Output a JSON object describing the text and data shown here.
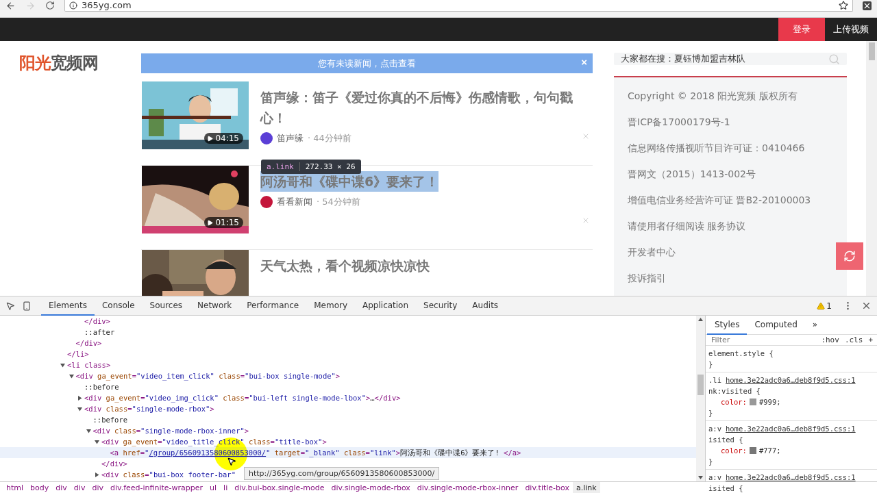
{
  "browser": {
    "url": "365yg.com",
    "forward_disabled": true
  },
  "header": {
    "login": "登录",
    "upload": "上传视频"
  },
  "logo": {
    "accent": "阳光",
    "rest": "宽频网"
  },
  "notice": {
    "text": "您有未读新闻，点击查看",
    "close": "×"
  },
  "feed": [
    {
      "title": "笛声缘：笛子《爱过你真的不后悔》伤感情歌，句句戳心！",
      "duration": "04:15",
      "source": "笛声缘",
      "dot": "·",
      "time": "44分钟前",
      "highlighted": false
    },
    {
      "title": "阿汤哥和《碟中谍6》要来了！",
      "duration": "01:15",
      "source": "看看新闻",
      "dot": "·",
      "time": "54分钟前",
      "highlighted": true
    },
    {
      "title": "天气太热，看个视频凉快凉快",
      "highlighted": false
    }
  ],
  "inspect_tooltip": {
    "selector": "a.link",
    "size": "272.33 × 26"
  },
  "search": {
    "placeholder": "大家都在搜：夏钰博加盟吉林队"
  },
  "footer_links": [
    "Copyright © 2018 阳光宽频 版权所有",
    "晋ICP备17000179号-1",
    "信息网络传播视听节目许可证：0410466",
    "晋网文（2015）1413-002号",
    "增值电信业务经营许可证 晋B2-20100003",
    "请使用者仔细阅读 服务协议",
    "开发者中心",
    "投诉指引"
  ],
  "devtools": {
    "tabs": [
      {
        "label": "Elements",
        "selected": true
      },
      {
        "label": "Console",
        "selected": false
      },
      {
        "label": "Sources",
        "selected": false
      },
      {
        "label": "Network",
        "selected": false
      },
      {
        "label": "Performance",
        "selected": false
      },
      {
        "label": "Memory",
        "selected": false
      },
      {
        "label": "Application",
        "selected": false
      },
      {
        "label": "Security",
        "selected": false
      },
      {
        "label": "Audits",
        "selected": false
      }
    ],
    "warnings": "1",
    "tree": [
      {
        "children": [
          {
            "children": [
              {
                "text": "</div>"
              },
              {
                "text": "::after"
              }
            ]
          },
          {
            "text": "</div>"
          }
        ]
      },
      {
        "text": "</li>"
      },
      {
        "text": "<li class>",
        "expanded": true,
        "children": [
          {
            "text": "<div ga_event=\"video_item_click\" class=\"bui-box single-mode\">",
            "expanded": true,
            "children": [
              {
                "text": "::before"
              },
              {
                "text": "<div ga_event=\"video_img_click\" class=\"bui-left single-mode-lbox\">…</div>",
                "expanded": false
              },
              {
                "text": "<div class=\"single-mode-rbox\">",
                "expanded": true,
                "children": [
                  {
                    "text": "::before"
                  },
                  {
                    "text": "<div class=\"single-mode-rbox-inner\">",
                    "expanded": true,
                    "children": [
                      {
                        "text": "<div ga_event=\"video_title_click\" class=\"title-box\">",
                        "expanded": true,
                        "children": [
                          {
                            "text": "<a href=\"/group/6560913580600853000/\" target=\"_blank\" class=\"link\">阿汤哥和《碟中谍6》要来了! </a>",
                            "selected": true
                          }
                        ]
                      },
                      {
                        "text": "</div>"
                      },
                      {
                        "text": "<div class=\"bui-box footer-bar\"",
                        "expanded": false
                      }
                    ]
                  }
                ]
              }
            ]
          }
        ]
      }
    ],
    "link_tooltip": "http://365yg.com/group/6560913580600853000/",
    "breadcrumbs": [
      {
        "label": "html",
        "selected": false
      },
      {
        "label": "body",
        "selected": false
      },
      {
        "label": "div",
        "selected": false
      },
      {
        "label": "div",
        "selected": false
      },
      {
        "label": "div",
        "selected": false
      },
      {
        "label": "div.feed-infinite-wrapper",
        "selected": false
      },
      {
        "label": "ul",
        "selected": false
      },
      {
        "label": "li",
        "selected": false
      },
      {
        "label": "div.bui-box.single-mode",
        "selected": false
      },
      {
        "label": "div.single-mode-rbox",
        "selected": false
      },
      {
        "label": "div.single-mode-rbox-inner",
        "selected": false
      },
      {
        "label": "div.title-box",
        "selected": false
      },
      {
        "label": "a.link",
        "selected": true
      }
    ],
    "styles_tabs": [
      {
        "label": "Styles",
        "selected": true
      },
      {
        "label": "Computed",
        "selected": false
      }
    ],
    "more_tabs": "»",
    "filter": {
      "placeholder": "Filter"
    },
    "filter_buttons": [
      ":hov",
      ".cls",
      "+"
    ],
    "rules": [
      {
        "selector": "element.style {",
        "close": "}"
      },
      {
        "selector": ".li",
        "source": "home.3e22adc0a6…deb8f9d5.css:1",
        "selector_rest": "nk:visited {",
        "props": [
          {
            "name": "color:",
            "value": "#999;",
            "color": "#999999"
          }
        ],
        "close": "}"
      },
      {
        "selector": "a:v",
        "source": "home.3e22adc0a6…deb8f9d5.css:1",
        "selector_rest": "isited {",
        "props": [
          {
            "name": "color:",
            "value": "#777;",
            "color": "#777777"
          }
        ],
        "close": "}"
      },
      {
        "selector": "a:v",
        "source": "home.3e22adc0a6…deb8f9d5.css:1",
        "selector_rest": "isited {"
      }
    ]
  }
}
